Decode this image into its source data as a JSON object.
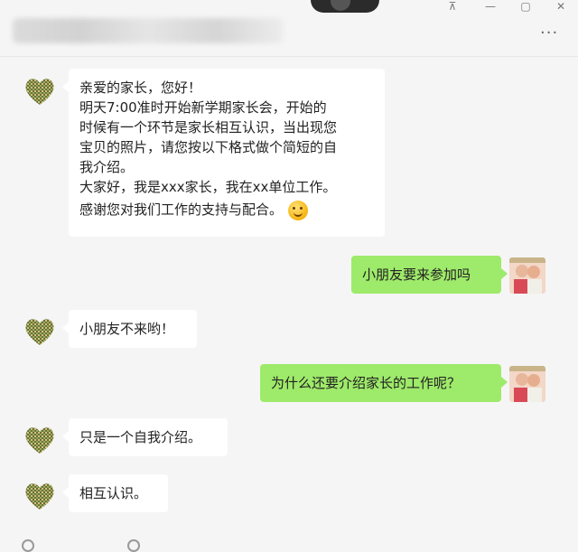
{
  "window": {
    "controls": {
      "pin": "⊼",
      "minimize": "—",
      "maximize": "▢",
      "close": "✕"
    },
    "more_label": "···"
  },
  "messages": [
    {
      "lines": [
        "亲爱的家长，您好！",
        "明天7:00准时开始新学期家长会，开始的",
        "时候有一个环节是家长相互认识，当出现您",
        "宝贝的照片，请您按以下格式做个简短的自",
        "我介绍。",
        "大家好，我是xxx家长，我在xx单位工作。",
        "感谢您对我们工作的支持与配合。"
      ]
    },
    {
      "text": "小朋友要来参加吗"
    },
    {
      "text": "小朋友不来哟！"
    },
    {
      "text": "为什么还要介绍家长的工作呢？"
    },
    {
      "text": "只是一个自我介绍。"
    },
    {
      "text": "相互认识。"
    }
  ],
  "colors": {
    "incoming": "#ffffff",
    "outgoing": "#9eea6a",
    "background": "#f5f5f5"
  },
  "icons": {
    "avatar_left": "heart-mosaic-avatar",
    "avatar_right": "photo-avatar",
    "emoji": "smile-emoji"
  }
}
